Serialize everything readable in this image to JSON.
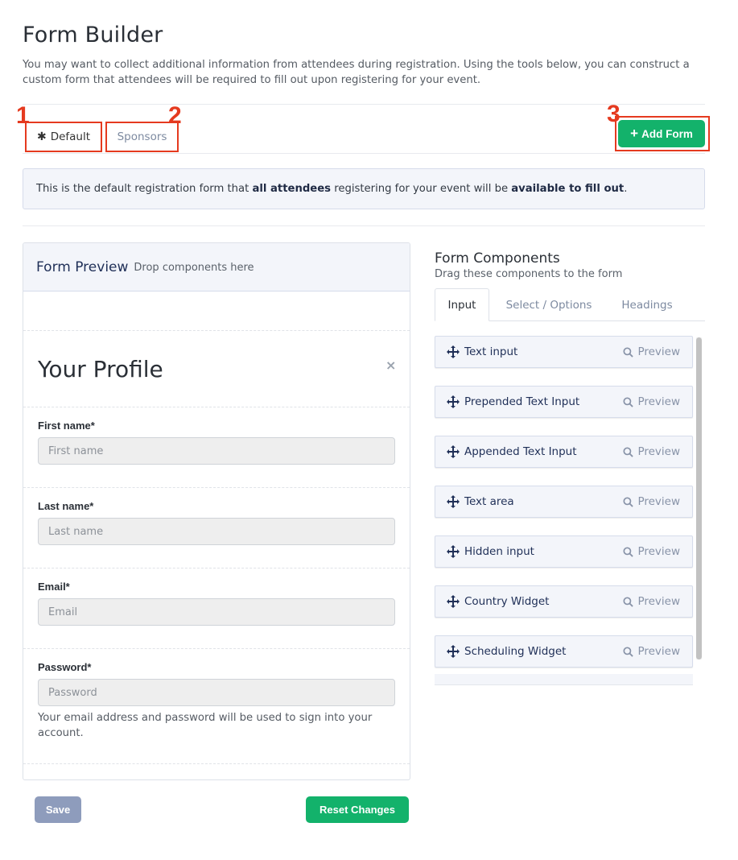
{
  "header": {
    "title": "Form Builder",
    "description": "You may want to collect additional information from attendees during registration. Using the tools below, you can construct a custom form that attendees will be required to fill out upon registering for your event."
  },
  "markers": [
    "1",
    "2",
    "3"
  ],
  "tabs": [
    {
      "icon": "asterisk-icon",
      "symbol": "✱",
      "label": "Default",
      "active": true
    },
    {
      "label": "Sponsors",
      "active": false
    }
  ],
  "add_form": {
    "plus": "+",
    "label": "Add Form"
  },
  "info": {
    "part1": "This is the default registration form that ",
    "bold1": "all attendees",
    "part2": " registering for your event will be ",
    "bold2": "available to fill out",
    "part3": "."
  },
  "preview": {
    "title": "Form Preview",
    "subtitle": "Drop components here",
    "heading": "Your Profile",
    "close": "×",
    "fields": [
      {
        "label": "First name*",
        "placeholder": "First name"
      },
      {
        "label": "Last name*",
        "placeholder": "Last name"
      },
      {
        "label": "Email*",
        "placeholder": "Email"
      },
      {
        "label": "Password*",
        "placeholder": "Password"
      }
    ],
    "help": "Your email address and password will be used to sign into your account."
  },
  "actions": {
    "save": "Save",
    "reset": "Reset Changes"
  },
  "components": {
    "title": "Form Components",
    "subtitle": "Drag these components to the form",
    "tabs": [
      {
        "label": "Input",
        "active": true
      },
      {
        "label": "Select / Options",
        "active": false
      },
      {
        "label": "Headings",
        "active": false
      }
    ],
    "preview_label": "Preview",
    "items": [
      {
        "name": "Text input"
      },
      {
        "name": "Prepended Text Input"
      },
      {
        "name": "Appended Text Input"
      },
      {
        "name": "Text area"
      },
      {
        "name": "Hidden input"
      },
      {
        "name": "Country Widget"
      },
      {
        "name": "Scheduling Widget"
      }
    ]
  },
  "colors": {
    "accent_green": "#13b26b",
    "highlight_red": "#e53a1f",
    "navy_text": "#1f2f57",
    "save_disabled": "#8e9cbc"
  }
}
